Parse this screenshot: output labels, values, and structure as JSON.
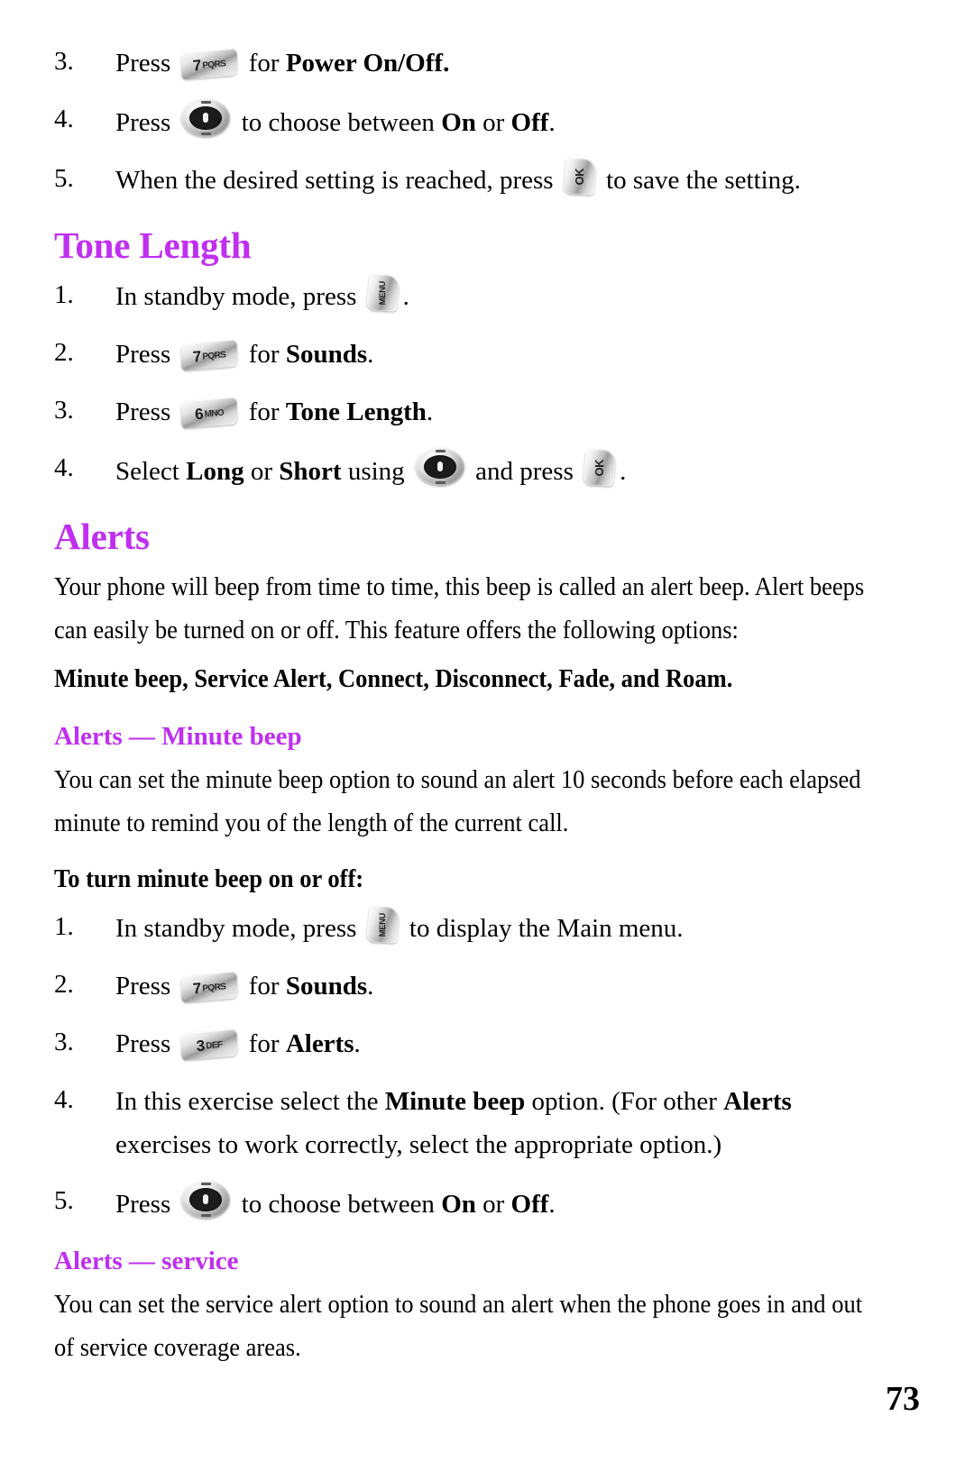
{
  "document": {
    "page_number": "73",
    "heading_color": "#c02ff0",
    "body_color": "#000000",
    "background": "#ffffff"
  },
  "icons": {
    "key7": {
      "digit": "7",
      "letters": "PQRS",
      "name": "key-7-pqrs-icon"
    },
    "key6": {
      "digit": "6",
      "letters": "MNO",
      "name": "key-6-mno-icon"
    },
    "key3": {
      "digit": "3",
      "letters": "DEF",
      "name": "key-3-def-icon"
    },
    "nav": {
      "label": "navigation-key",
      "name": "navigation-key-icon"
    },
    "menu": {
      "label": "MENU",
      "name": "menu-soft-key-icon"
    },
    "ok": {
      "label": "OK",
      "name": "ok-soft-key-icon"
    }
  },
  "top_steps": [
    {
      "num": "3.",
      "pre": "Press",
      "icon": "key7",
      "mid": "for",
      "bold": "Power On/Off",
      "post": "."
    },
    {
      "num": "4.",
      "pre": "Press",
      "icon": "nav",
      "mid": "to choose between",
      "bold": "On",
      "mid2": "or",
      "bold2": "Off",
      "post": "."
    },
    {
      "num": "5.",
      "pre": "When the desired setting is reached, press",
      "icon": "ok",
      "mid": "to save the setting.",
      "post": ""
    }
  ],
  "tone_length": {
    "heading": "Tone Length",
    "steps": [
      {
        "num": "1.",
        "pre": "In standby mode, press",
        "icon": "menu",
        "post": "."
      },
      {
        "num": "2.",
        "pre": "Press",
        "icon": "key7",
        "mid": "for",
        "bold": "Sounds",
        "post": "."
      },
      {
        "num": "3.",
        "pre": "Press",
        "icon": "key6",
        "mid": "for",
        "bold": "Tone Length",
        "post": "."
      },
      {
        "num": "4.",
        "pre": "Select",
        "bold": "Long",
        "mid": "or",
        "bold2": "Short",
        "mid2": "using",
        "icon": "nav",
        "mid3": "and press",
        "icon2": "ok",
        "post": "."
      }
    ]
  },
  "alerts": {
    "heading": "Alerts",
    "paragraph": "Your phone will beep from time to time, this beep is called an alert beep. Alert beeps can easily be turned on or off. This feature offers the following options:",
    "options_line": "Minute beep, Service Alert, Connect, Disconnect, Fade, and Roam.",
    "minute_beep": {
      "heading": "Alerts — Minute beep",
      "paragraph": "You can set the minute beep option to sound an alert 10 seconds before each elapsed minute to remind you of the length of the current call.",
      "lead_in": "To turn minute beep on or off:",
      "steps": [
        {
          "num": "1.",
          "pre": "In standby mode, press",
          "icon": "menu",
          "mid": "to display the Main menu.",
          "post": ""
        },
        {
          "num": "2.",
          "pre": "Press",
          "icon": "key7",
          "mid": "for",
          "bold": "Sounds",
          "post": "."
        },
        {
          "num": "3.",
          "pre": "Press",
          "icon": "key3",
          "mid": "for",
          "bold": "Alerts",
          "post": "."
        },
        {
          "num": "4.",
          "pre": "In this exercise select the",
          "bold": "Minute beep",
          "mid": "option. (For other",
          "bold2": "Alerts",
          "mid2": "exercises to work correctly, select the appropriate option.)",
          "post": ""
        },
        {
          "num": "5.",
          "pre": "Press",
          "icon": "nav",
          "mid": "to choose between",
          "bold": "On",
          "mid2": "or",
          "bold2": "Off",
          "post": "."
        }
      ]
    },
    "service": {
      "heading": "Alerts — service",
      "paragraph": "You can set the service alert option to sound an alert when the phone goes in and out of service coverage areas."
    }
  }
}
